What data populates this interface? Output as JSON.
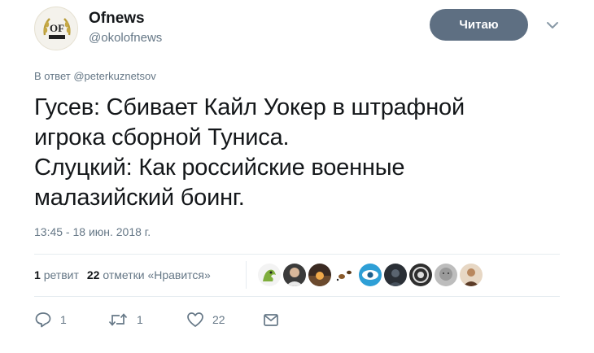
{
  "user": {
    "name": "Ofnews",
    "handle": "@okolofnews",
    "avatar_text": "OF"
  },
  "follow_button": {
    "label": "Читаю"
  },
  "reply_to": {
    "prefix": "В ответ",
    "mention": "@peterkuznetsov"
  },
  "tweet": {
    "lines": [
      "Гусев: Сбивает Кайл Уокер в штрафной",
      "игрока сборной Туниса.",
      "Слуцкий: Как российские военные",
      "малазийский боинг."
    ]
  },
  "timestamp": "13:45 - 18 июн. 2018 г.",
  "stats": {
    "retweets_count": "1",
    "retweets_label": "ретвит",
    "likes_count": "22",
    "likes_label": "отметки «Нравится»"
  },
  "likers": [
    {
      "icon": "dragon-avatar",
      "color": "#7fae3d"
    },
    {
      "icon": "person-avatar",
      "color": "#4d4d4d"
    },
    {
      "icon": "sunset-avatar",
      "color": "#6b4a2e"
    },
    {
      "icon": "bugs-avatar",
      "color": "#d9d2c5"
    },
    {
      "icon": "eye-logo-avatar",
      "color": "#2e9fd6"
    },
    {
      "icon": "dark-avatar",
      "color": "#2a2f36"
    },
    {
      "icon": "pattern-avatar",
      "color": "#3d3d3d"
    },
    {
      "icon": "face-avatar",
      "color": "#9a9a9a"
    },
    {
      "icon": "portrait-avatar",
      "color": "#b8875e"
    }
  ],
  "actions": {
    "reply_count": "1",
    "retweet_count": "1",
    "like_count": "22"
  },
  "colors": {
    "follow_button": "#5e6f82",
    "muted": "#657786",
    "text": "#14171a"
  }
}
